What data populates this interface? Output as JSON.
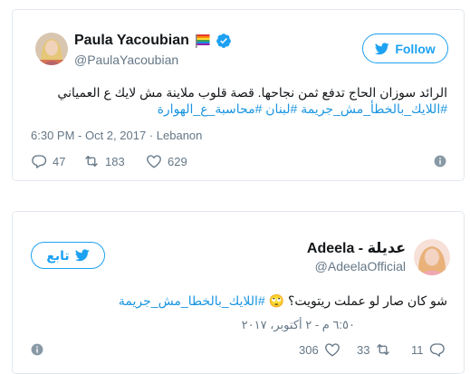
{
  "tweet1": {
    "name": "Paula Yacoubian",
    "handle": "@PaulaYacoubian",
    "follow_label": "Follow",
    "text_line1": "الرائد سوزان الحاج تدفع ثمن نجاحها. قصة قلوب ملاينة مش لايك ع العمياني",
    "hashtags_line": "#اللايك_بالخطأ_مش_جريمة #لبنان #محاسبة_ع_الهوارة",
    "timestamp": "6:30 PM - Oct 2, 2017",
    "separator": "·",
    "location": "Lebanon",
    "replies": "47",
    "retweets": "183",
    "likes": "629",
    "accent_color": "#1da1f2"
  },
  "tweet2": {
    "name": "Adeela - عديلة",
    "handle": "@AdeelaOfficial",
    "follow_label": "تابع",
    "text_line1": "شو كان صار لو عملت ريتويت؟",
    "emoji": "🙄",
    "hashtag": "#اللايك_بالخطا_مش_جريمة",
    "timestamp": "٦:٥٠ م - ٢ أكتوبر، ٢٠١٧",
    "likes": "306",
    "retweets": "33",
    "replies": "11"
  }
}
